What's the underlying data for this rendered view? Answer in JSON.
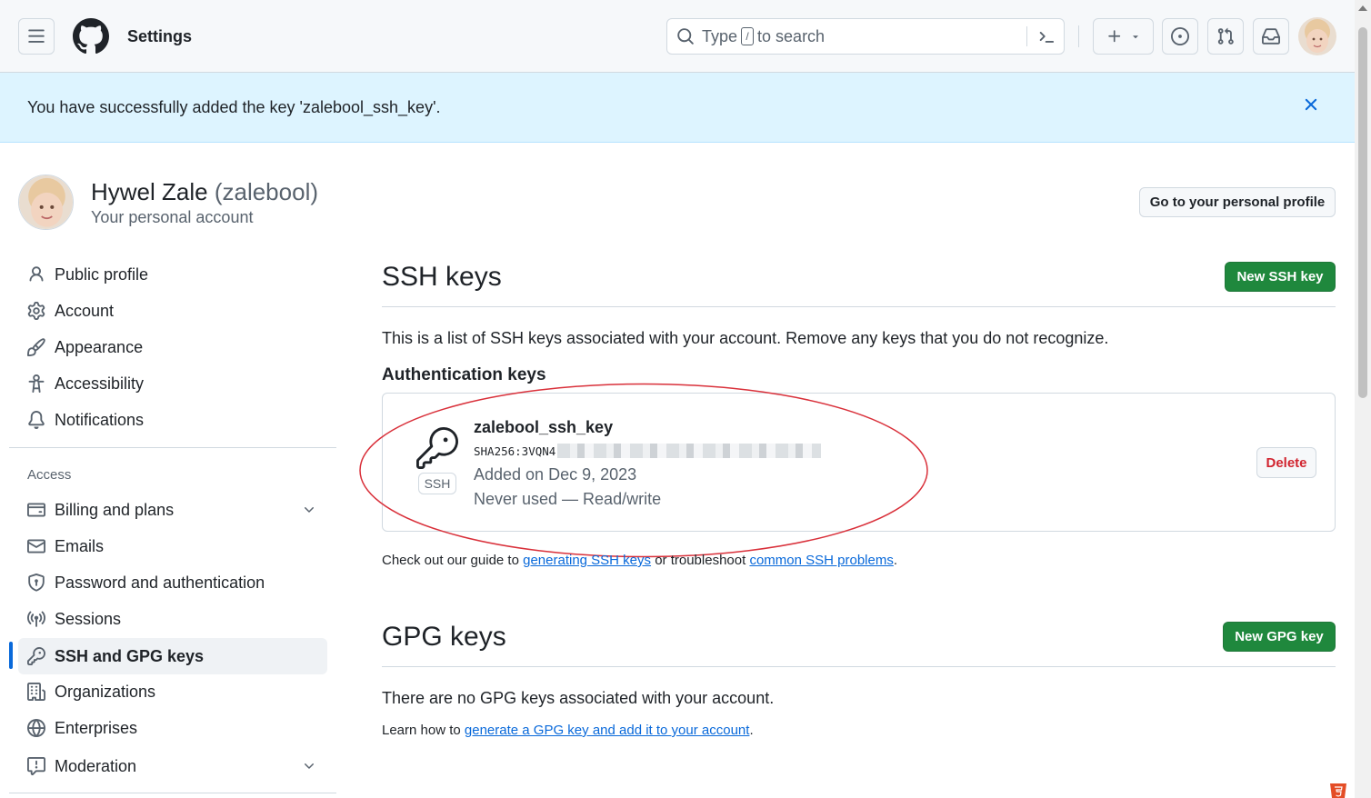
{
  "header": {
    "title": "Settings",
    "search": {
      "prefix": "Type",
      "key": "/",
      "suffix": "to search"
    }
  },
  "flash": {
    "message": "You have successfully added the key 'zalebool_ssh_key'."
  },
  "profile": {
    "name": "Hywel Zale",
    "login": "(zalebool)",
    "subtitle": "Your personal account",
    "profile_button": "Go to your personal profile"
  },
  "sidebar": {
    "items": [
      {
        "label": "Public profile",
        "icon": "person-icon"
      },
      {
        "label": "Account",
        "icon": "gear-icon"
      },
      {
        "label": "Appearance",
        "icon": "paintbrush-icon"
      },
      {
        "label": "Accessibility",
        "icon": "accessibility-icon"
      },
      {
        "label": "Notifications",
        "icon": "bell-icon"
      }
    ],
    "access_heading": "Access",
    "access_items": [
      {
        "label": "Billing and plans",
        "icon": "credit-card-icon",
        "expandable": true
      },
      {
        "label": "Emails",
        "icon": "mail-icon"
      },
      {
        "label": "Password and authentication",
        "icon": "shield-lock-icon"
      },
      {
        "label": "Sessions",
        "icon": "broadcast-icon"
      },
      {
        "label": "SSH and GPG keys",
        "icon": "key-icon",
        "active": true
      },
      {
        "label": "Organizations",
        "icon": "organization-icon"
      },
      {
        "label": "Enterprises",
        "icon": "globe-icon"
      },
      {
        "label": "Moderation",
        "icon": "report-icon",
        "expandable": true
      }
    ]
  },
  "ssh": {
    "title": "SSH keys",
    "new_button": "New SSH key",
    "description": "This is a list of SSH keys associated with your account. Remove any keys that you do not recognize.",
    "auth_heading": "Authentication keys",
    "key": {
      "title": "zalebool_ssh_key",
      "fingerprint_prefix": "SHA256:3VQN4",
      "type": "SSH",
      "added": "Added on Dec 9, 2023",
      "usage": "Never used — Read/write",
      "delete_label": "Delete"
    },
    "guide": {
      "prefix": "Check out our guide to",
      "link1": "generating SSH keys",
      "middle": "or troubleshoot",
      "link2": "common SSH problems",
      "suffix": "."
    }
  },
  "gpg": {
    "title": "GPG keys",
    "new_button": "New GPG key",
    "empty": "There are no GPG keys associated with your account.",
    "learn": {
      "prefix": "Learn how to",
      "link": "generate a GPG key and add it to your account",
      "suffix": "."
    }
  },
  "colors": {
    "accent": "#0969da",
    "primary_button": "#1f883d",
    "danger": "#d1242f",
    "flash_bg": "#ddf4ff",
    "annotation": "#d9303a"
  }
}
